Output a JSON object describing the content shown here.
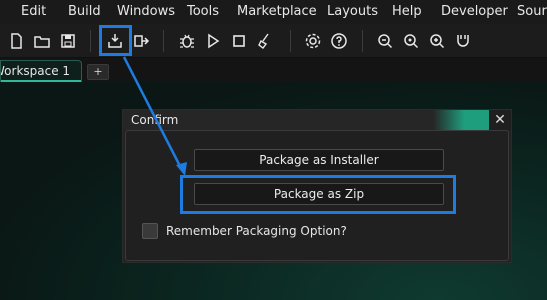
{
  "menubar": {
    "items": [
      "Edit",
      "Build",
      "Windows",
      "Tools",
      "Marketplace",
      "Layouts",
      "Help",
      "Developer",
      "Source"
    ]
  },
  "toolbar": {
    "icons": [
      "new-file-icon",
      "open-folder-icon",
      "save-icon",
      "package-icon",
      "export-icon",
      "debug-icon",
      "play-icon",
      "stop-icon",
      "clean-icon",
      "settings-icon",
      "help-icon",
      "zoom-out-icon",
      "zoom-reset-icon",
      "zoom-in-icon",
      "extensions-icon"
    ]
  },
  "tabs": {
    "active_label": "Workspace 1",
    "add_label": "+"
  },
  "dialog": {
    "title": "Confirm",
    "close_glyph": "✕",
    "installer_label": "Package as Installer",
    "zip_label": "Package as Zip",
    "remember_label": "Remember Packaging Option?",
    "remember_checked": false
  },
  "colors": {
    "accent": "#1f9e7d",
    "highlight": "#1e7be0"
  }
}
